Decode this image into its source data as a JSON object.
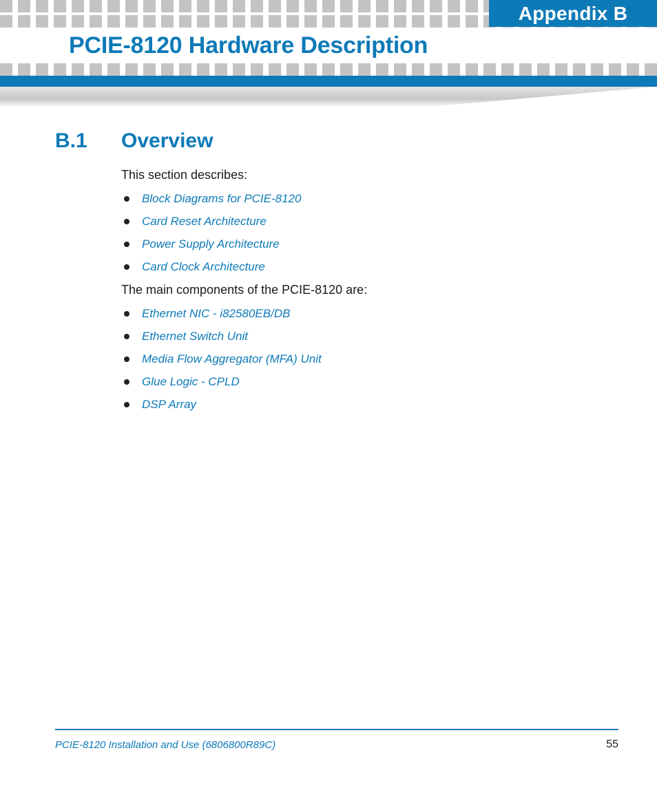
{
  "header": {
    "appendix_label": "Appendix B",
    "title": "PCIE-8120 Hardware Description"
  },
  "section": {
    "number": "B.1",
    "title": "Overview",
    "intro1": "This section describes:",
    "list1": {
      "0": "Block Diagrams for PCIE-8120",
      "1": "Card Reset Architecture",
      "2": "Power Supply Architecture",
      "3": "Card Clock Architecture"
    },
    "intro2": "The main components of the PCIE-8120 are:",
    "list2": {
      "0": "Ethernet NIC - i82580EB/DB",
      "1": "Ethernet Switch Unit",
      "2": "Media Flow Aggregator (MFA) Unit",
      "3": "Glue Logic - CPLD",
      "4": "DSP Array"
    }
  },
  "footer": {
    "doc_title": "PCIE-8120 Installation and Use (6806800R89C)",
    "page_number": "55"
  }
}
